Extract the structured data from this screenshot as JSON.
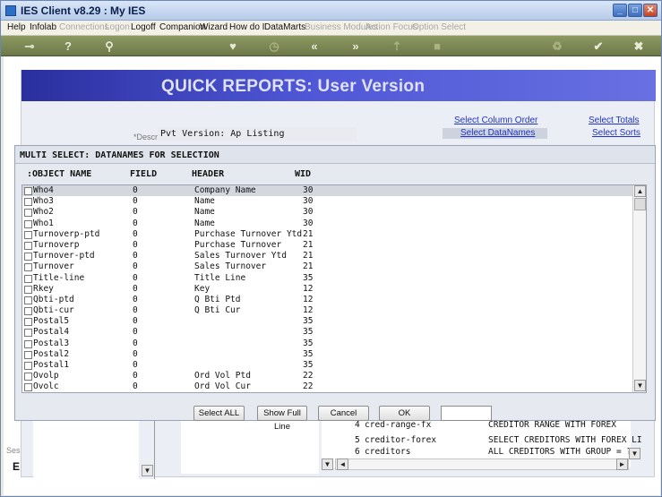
{
  "window": {
    "title": "IES Client v8.29 : My IES",
    "min": "_",
    "max": "□",
    "close": "✕"
  },
  "menu": [
    {
      "label": "Help",
      "enabled": true
    },
    {
      "label": "Infolab",
      "enabled": true
    },
    {
      "label": "Connections",
      "enabled": false
    },
    {
      "label": "Logon",
      "enabled": false
    },
    {
      "label": "Logoff",
      "enabled": true
    },
    {
      "label": "Companion",
      "enabled": true
    },
    {
      "label": "Wizard",
      "enabled": true
    },
    {
      "label": "How do I",
      "enabled": true
    },
    {
      "label": "DataMarts",
      "enabled": true
    },
    {
      "label": "Business Modules",
      "enabled": false
    },
    {
      "label": "Action Focus",
      "enabled": false
    },
    {
      "label": "Option Select",
      "enabled": false
    }
  ],
  "toolbar": [
    {
      "icon": "key-icon",
      "glyph": "⊸"
    },
    {
      "icon": "help-icon",
      "glyph": "?"
    },
    {
      "icon": "search-icon",
      "glyph": "⚲"
    },
    {
      "icon": "heart-icon",
      "glyph": "♥"
    },
    {
      "icon": "clock-icon",
      "glyph": "◷"
    },
    {
      "icon": "rewind-icon",
      "glyph": "«"
    },
    {
      "icon": "forward-icon",
      "glyph": "»"
    },
    {
      "icon": "upload-icon",
      "glyph": "⇡"
    },
    {
      "icon": "square-icon",
      "glyph": "■"
    },
    {
      "icon": "recycle-icon",
      "glyph": "♻"
    },
    {
      "icon": "check-icon",
      "glyph": "✔"
    },
    {
      "icon": "close-icon",
      "glyph": "✖"
    }
  ],
  "report": {
    "title": "QUICK REPORTS: User Version",
    "descr_label": "*Descr",
    "descr_value": "Pvt Version: Ap Listing",
    "links": {
      "select_column_order": "Select Column Order",
      "select_totals": "Select Totals",
      "select_datanames": "Select DataNames",
      "select_sorts": "Select Sorts"
    }
  },
  "dialog": {
    "title": "MULTI SELECT: DATANAMES FOR SELECTION",
    "columns": {
      "object_name": ":OBJECT NAME",
      "field": "FIELD",
      "header": "HEADER",
      "wid": "WID"
    },
    "rows": [
      {
        "name": "Who4",
        "field": "0",
        "header": "Company Name",
        "wid": "30"
      },
      {
        "name": "Who3",
        "field": "0",
        "header": "Name",
        "wid": "30"
      },
      {
        "name": "Who2",
        "field": "0",
        "header": "Name",
        "wid": "30"
      },
      {
        "name": "Who1",
        "field": "0",
        "header": "Name",
        "wid": "30"
      },
      {
        "name": "Turnoverp-ptd",
        "field": "0",
        "header": "Purchase Turnover Ytd",
        "wid": "21"
      },
      {
        "name": "Turnoverp",
        "field": "0",
        "header": "Purchase Turnover",
        "wid": "21"
      },
      {
        "name": "Turnover-ptd",
        "field": "0",
        "header": "Sales Turnover Ytd",
        "wid": "21"
      },
      {
        "name": "Turnover",
        "field": "0",
        "header": "Sales Turnover",
        "wid": "21"
      },
      {
        "name": "Title-line",
        "field": "0",
        "header": "Title Line",
        "wid": "35"
      },
      {
        "name": "Rkey",
        "field": "0",
        "header": "Key",
        "wid": "12"
      },
      {
        "name": "Qbti-ptd",
        "field": "0",
        "header": "Q Bti Ptd",
        "wid": "12"
      },
      {
        "name": "Qbti-cur",
        "field": "0",
        "header": "Q Bti Cur",
        "wid": "12"
      },
      {
        "name": "Postal5",
        "field": "0",
        "header": "",
        "wid": "35"
      },
      {
        "name": "Postal4",
        "field": "0",
        "header": "",
        "wid": "35"
      },
      {
        "name": "Postal3",
        "field": "0",
        "header": "",
        "wid": "35"
      },
      {
        "name": "Postal2",
        "field": "0",
        "header": "",
        "wid": "35"
      },
      {
        "name": "Postal1",
        "field": "0",
        "header": "",
        "wid": "35"
      },
      {
        "name": "Ovolp",
        "field": "0",
        "header": "Ord Vol Ptd",
        "wid": "22"
      },
      {
        "name": "Ovolc",
        "field": "0",
        "header": "Ord Vol Cur",
        "wid": "22"
      }
    ],
    "buttons": {
      "select_all": "Select ALL",
      "show_full_line": "Show Full Line",
      "cancel": "Cancel",
      "ok": "OK"
    }
  },
  "below_list": [
    {
      "num": "4",
      "code": "cred-range-fx",
      "desc": "CREDITOR RANGE WITH FOREX"
    },
    {
      "num": "5",
      "code": "creditor-forex",
      "desc": "SELECT CREDITORS WITH FOREX LI"
    },
    {
      "num": "6",
      "code": "creditors",
      "desc": "ALL CREDITORS WITH GROUP = ?"
    }
  ],
  "left_partial": {
    "ses": "Ses",
    "e": "E"
  }
}
